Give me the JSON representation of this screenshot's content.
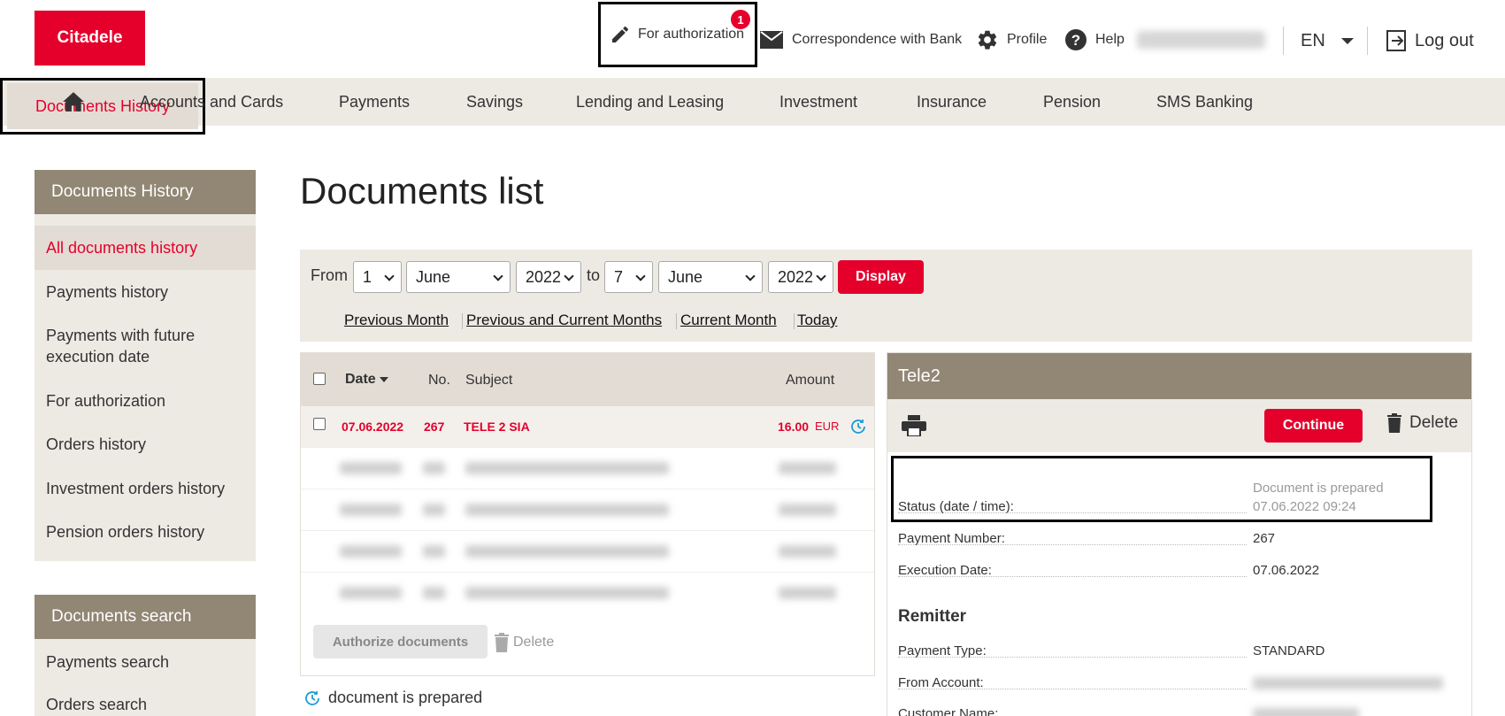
{
  "header": {
    "logo": "Citadele",
    "for_authorization": "For authorization",
    "auth_badge": "1",
    "correspondence": "Correspondence with Bank",
    "profile": "Profile",
    "help": "Help",
    "language": "EN",
    "logout": "Log out"
  },
  "nav": {
    "items": [
      "Accounts and Cards",
      "Payments",
      "Savings",
      "Lending and Leasing",
      "Investment",
      "Insurance",
      "Pension",
      "SMS Banking"
    ],
    "active": "Documents History"
  },
  "sidebar": {
    "history_title": "Documents History",
    "history_items": [
      "All documents history",
      "Payments history",
      "Payments with future execution date",
      "For authorization",
      "Orders history",
      "Investment orders history",
      "Pension orders history"
    ],
    "search_title": "Documents search",
    "search_items": [
      "Payments search",
      "Orders search"
    ]
  },
  "main": {
    "title": "Documents list",
    "filter": {
      "from_label": "From",
      "to_label": "to",
      "from_day": "1",
      "from_month": "June",
      "from_year": "2022",
      "to_day": "7",
      "to_month": "June",
      "to_year": "2022",
      "display": "Display",
      "links": [
        "Previous Month",
        "Previous and Current Months",
        "Current Month",
        "Today"
      ]
    },
    "table": {
      "headers": {
        "date": "Date",
        "no": "No.",
        "subject": "Subject",
        "amount": "Amount"
      },
      "row": {
        "date": "07.06.2022",
        "no": "267",
        "subject": "TELE 2 SIA",
        "amount": "16.00",
        "currency": "EUR"
      },
      "authorize": "Authorize documents",
      "delete": "Delete"
    },
    "legend": "document is prepared"
  },
  "detail": {
    "title": "Tele2",
    "continue": "Continue",
    "delete": "Delete",
    "status_label": "Status (date / time):",
    "status_value_1": "Document is prepared",
    "status_value_2": "07.06.2022 09:24",
    "payment_number_label": "Payment Number:",
    "payment_number": "267",
    "execution_date_label": "Execution Date:",
    "execution_date": "07.06.2022",
    "remitter_title": "Remitter",
    "payment_type_label": "Payment Type:",
    "payment_type": "STANDARD",
    "from_account_label": "From Account:",
    "customer_name_label": "Customer Name:"
  },
  "colors": {
    "brand": "#e4002b",
    "nav_bg": "#edeae4",
    "panel_head": "#928674",
    "status_icon": "#1e9bd7"
  }
}
